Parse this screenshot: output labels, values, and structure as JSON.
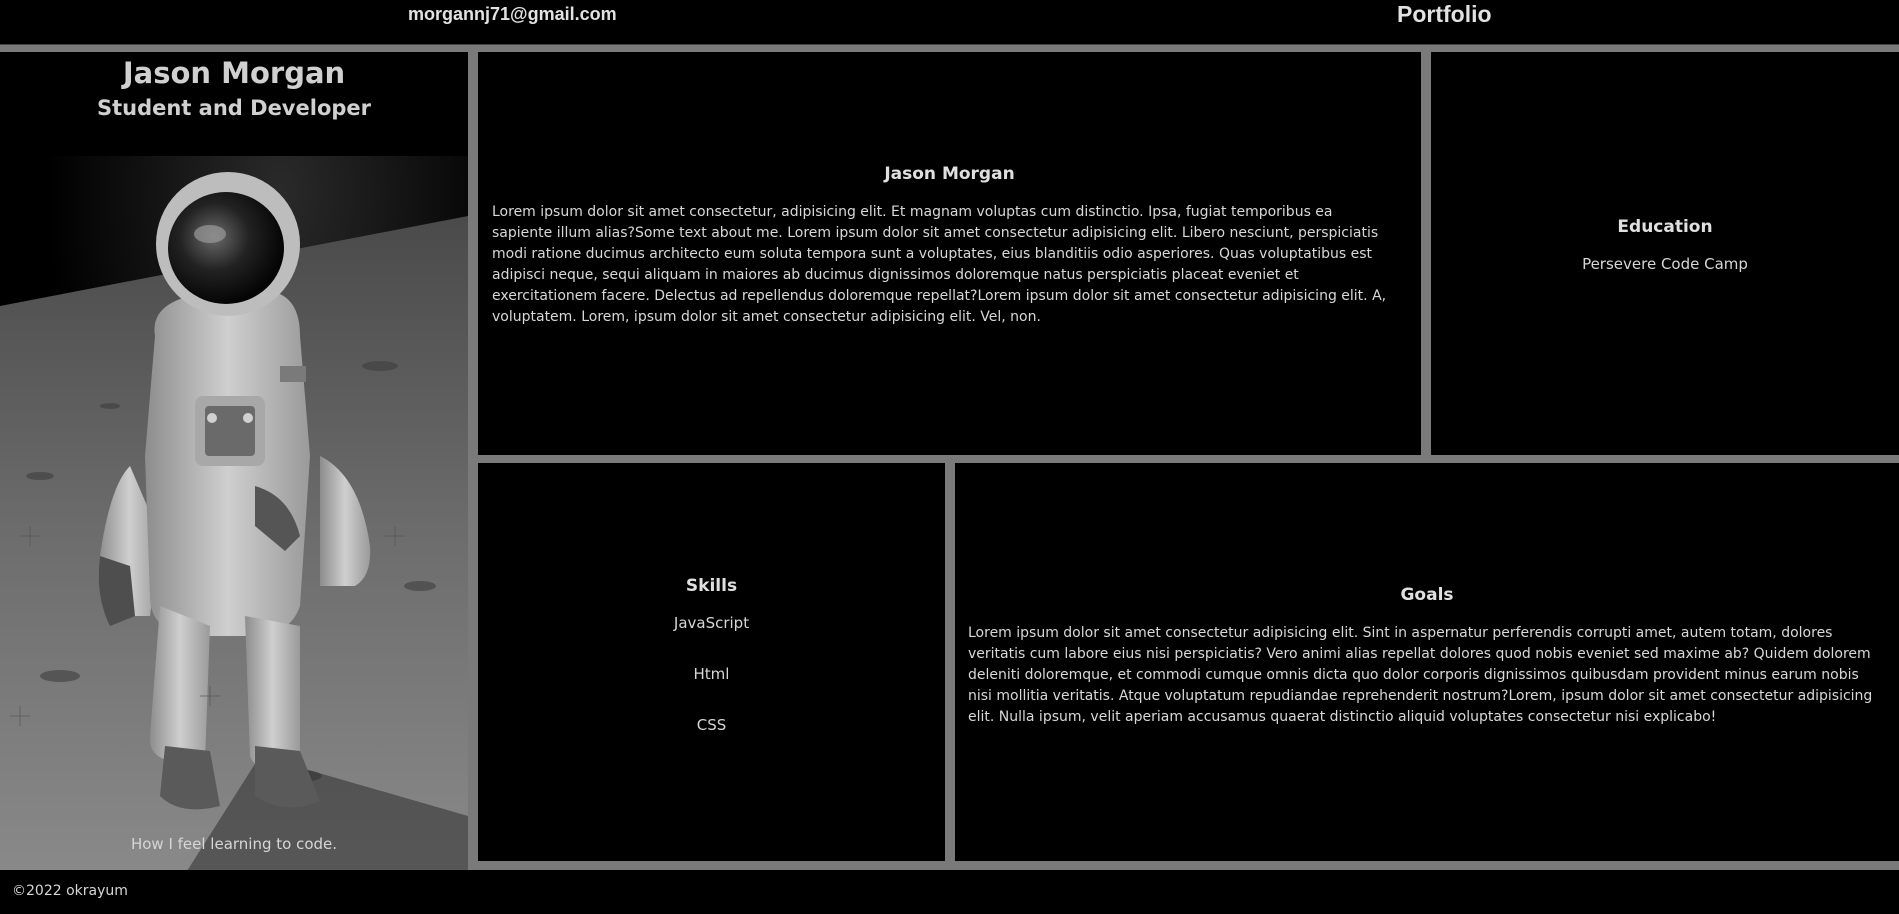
{
  "header": {
    "email": "morgannj71@gmail.com",
    "brand": "Portfolio"
  },
  "profile": {
    "name": "Jason Morgan",
    "role": "Student and Developer",
    "photo_caption": "How I feel learning to code."
  },
  "about": {
    "title": "Jason Morgan",
    "text": "Lorem ipsum dolor sit amet consectetur, adipisicing elit. Et magnam voluptas cum distinctio. Ipsa, fugiat temporibus ea sapiente illum alias?Some text about me. Lorem ipsum dolor sit amet consectetur adipisicing elit. Libero nesciunt, perspiciatis modi ratione ducimus architecto eum soluta tempora sunt a voluptates, eius blanditiis odio asperiores. Quas voluptatibus est adipisci neque, sequi aliquam in maiores ab ducimus dignissimos doloremque natus perspiciatis placeat eveniet et exercitationem facere. Delectus ad repellendus doloremque repellat?Lorem ipsum dolor sit amet consectetur adipisicing elit. A, voluptatem. Lorem, ipsum dolor sit amet consectetur adipisicing elit. Vel, non."
  },
  "education": {
    "title": "Education",
    "items": [
      "Persevere Code Camp"
    ]
  },
  "skills": {
    "title": "Skills",
    "items": [
      "JavaScript",
      "Html",
      "CSS"
    ]
  },
  "goals": {
    "title": "Goals",
    "text": "Lorem ipsum dolor sit amet consectetur adipisicing elit. Sint in aspernatur perferendis corrupti amet, autem totam, dolores veritatis cum labore eius nisi perspiciatis? Vero animi alias repellat dolores quod nobis eveniet sed maxime ab? Quidem dolorem deleniti doloremque, et commodi cumque omnis dicta quo dolor corporis dignissimos quibusdam provident minus earum nobis nisi mollitia veritatis. Atque voluptatum repudiandae reprehenderit nostrum?Lorem, ipsum dolor sit amet consectetur adipisicing elit. Nulla ipsum, velit aperiam accusamus quaerat distinctio aliquid voluptates consectetur nisi explicabo!"
  },
  "footer": {
    "copyright": "©2022 okrayum"
  },
  "colors": {
    "background": "#000000",
    "gutter": "#7a7a7a",
    "text": "#d6d6d6"
  }
}
